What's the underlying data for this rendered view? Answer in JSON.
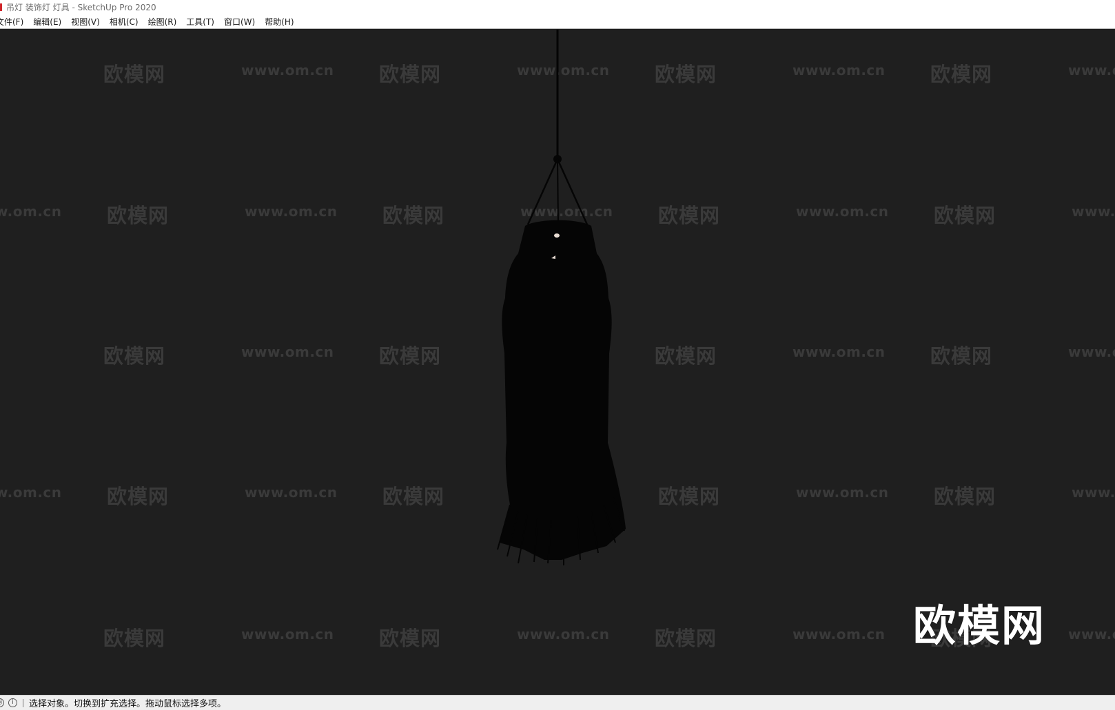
{
  "window": {
    "title": "吊灯 装饰灯 灯具 - SketchUp Pro 2020"
  },
  "menu": {
    "items": [
      "文件(F)",
      "编辑(E)",
      "视图(V)",
      "相机(C)",
      "绘图(R)",
      "工具(T)",
      "窗口(W)",
      "帮助(H)"
    ]
  },
  "viewport": {
    "background": "#1f1f1f",
    "watermark_cn": "欧模网",
    "watermark_url": "www.om.cn",
    "logo": "欧模网"
  },
  "status": {
    "message": "选择对象。切换到扩充选择。拖动鼠标选择多项。",
    "icons": [
      "geo-location-icon",
      "info-icon"
    ]
  }
}
